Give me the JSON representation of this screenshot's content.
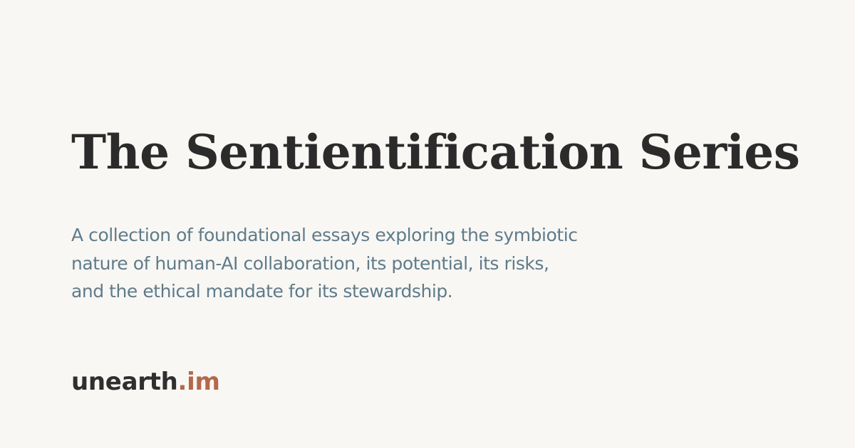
{
  "page": {
    "title": "The Sentientification Series",
    "description_lines": [
      "A collection of foundational essays exploring the symbiotic",
      "nature of human-AI collaboration, its potential, its risks,",
      "and the ethical mandate for its stewardship."
    ]
  },
  "brand": {
    "name": "unearth",
    "tld": ".im",
    "accent_color": "#b4684a"
  },
  "colors": {
    "background": "#f8f7f4",
    "title": "#2b2b2b",
    "description": "#5f7b8a"
  }
}
